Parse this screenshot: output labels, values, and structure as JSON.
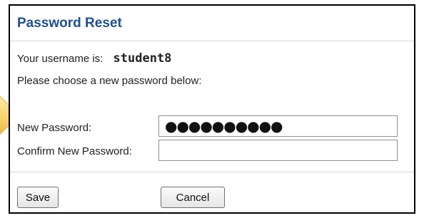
{
  "dialog": {
    "title": "Password Reset",
    "username_label": "Your username is:",
    "username_value": "student8",
    "instruction": "Please choose a new password below:",
    "new_password_label": "New Password:",
    "new_password_value": "●●●●●●●●●●",
    "confirm_password_label": "Confirm New Password:",
    "confirm_password_value": "",
    "save_label": "Save",
    "cancel_label": "Cancel"
  },
  "colors": {
    "title": "#1f4f91",
    "panel_border": "#000000",
    "arrow_fill": "#f7d774"
  }
}
